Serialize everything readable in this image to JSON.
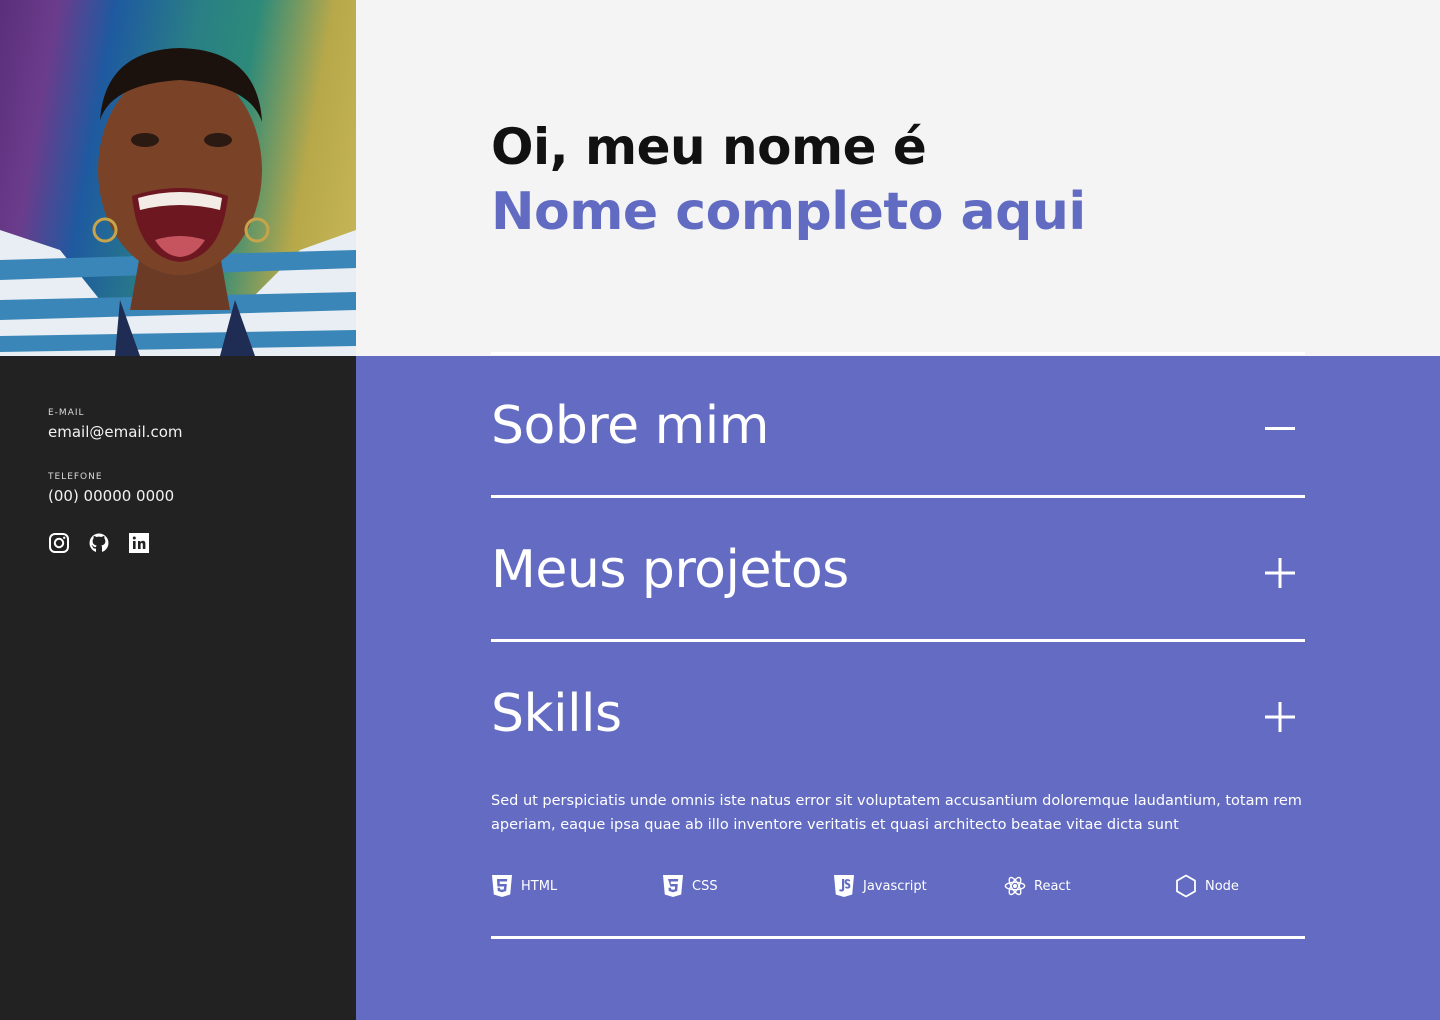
{
  "sidebar": {
    "email_label": "E-MAIL",
    "email_value": "email@email.com",
    "phone_label": "TELEFONE",
    "phone_value": "(00) 00000 0000",
    "social_icons": [
      "instagram-icon",
      "github-icon",
      "linkedin-icon"
    ]
  },
  "hero": {
    "greeting": "Oi, meu nome é",
    "name": "Nome completo aqui"
  },
  "sections": [
    {
      "title": "Sobre mim",
      "state": "expanded",
      "icon": "minus-icon"
    },
    {
      "title": "Meus projetos",
      "state": "collapsed",
      "icon": "plus-icon"
    },
    {
      "title": "Skills",
      "state": "collapsed",
      "icon": "plus-icon"
    }
  ],
  "skills": {
    "description": "Sed ut perspiciatis unde omnis iste natus error sit voluptatem accusantium doloremque laudantium, totam rem aperiam, eaque ipsa quae ab illo inventore veritatis et quasi architecto beatae vitae dicta sunt",
    "items": [
      {
        "label": "HTML",
        "icon": "html5-icon"
      },
      {
        "label": "CSS",
        "icon": "css3-icon"
      },
      {
        "label": "Javascript",
        "icon": "javascript-icon"
      },
      {
        "label": "React",
        "icon": "react-icon"
      },
      {
        "label": "Node",
        "icon": "node-icon"
      }
    ]
  },
  "colors": {
    "accent": "#636cc2",
    "sidebar_bg": "#222222",
    "hero_bg": "#f4f4f4",
    "text_light": "#ffffff"
  }
}
